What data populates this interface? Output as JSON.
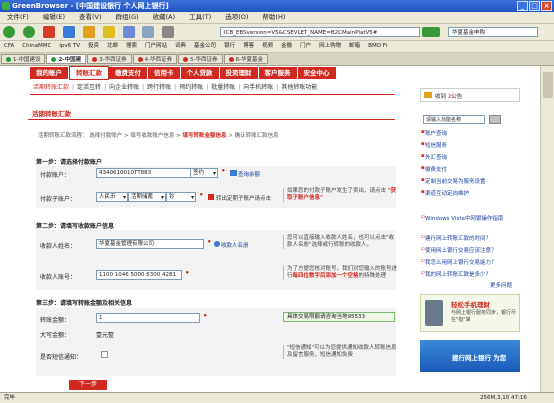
{
  "window": {
    "title": "GreenBrowser - [中国建设银行 个人网上银行]"
  },
  "menu": [
    "文件(F)",
    "编辑(E)",
    "查看(V)",
    "群组(G)",
    "收藏(A)",
    "工具(T)",
    "选项(O)",
    "帮助(H)"
  ],
  "address": {
    "value": "ICB_EBSversion=V5&CSEVLET_NAME=B2CMainPlatV5#"
  },
  "search": {
    "value": "华夏基金申购"
  },
  "links": [
    "CFA",
    "ChinaMMC",
    "ipv6 TV",
    "投资",
    "北邮",
    "搜索",
    "门户网站",
    "词典",
    "基金公司",
    "银行",
    "博客",
    "视频",
    "金融",
    "门户",
    "网上购物",
    "邮箱",
    "BMO Fi"
  ],
  "tabs": [
    {
      "label": "1-中国建设"
    },
    {
      "label": "2-中国建",
      "active": true
    },
    {
      "label": "3-华西证券"
    },
    {
      "label": "4-华西证券"
    },
    {
      "label": "5-华西证券"
    },
    {
      "label": "6-华夏基金"
    }
  ],
  "banknav": [
    {
      "label": "我的账户"
    },
    {
      "label": "转账汇款",
      "active": true
    },
    {
      "label": "缴费支付"
    },
    {
      "label": "信用卡"
    },
    {
      "label": "个人贷款"
    },
    {
      "label": "投资理财"
    },
    {
      "label": "客户服务"
    },
    {
      "label": "安全中心"
    }
  ],
  "subnav": [
    {
      "label": "活期转账汇款",
      "active": true
    },
    {
      "label": "定活互转"
    },
    {
      "label": "向企业转账"
    },
    {
      "label": "跨行转账"
    },
    {
      "label": "预约转账"
    },
    {
      "label": "批量转账"
    },
    {
      "label": "向手机转账"
    },
    {
      "label": "其他转账功能"
    }
  ],
  "page": {
    "title": "活期转账汇款"
  },
  "flow": {
    "prefix": "活期转账汇款流程：",
    "steps": [
      "选择付款账户",
      "填写收款账户信息",
      "填写转账金额信息",
      "确认转账汇款信息"
    ],
    "current": 2
  },
  "section1": {
    "title": "第一步：请选择付款账户",
    "account_label": "付款账户：",
    "account_value": "4340610010TT883",
    "sign_value": "签约",
    "balance_link": "查询余额",
    "subaccount_label": "付款子账户：",
    "currency": "人民币",
    "type": "活期储蓄",
    "cash": "钞",
    "regular_link": "转出定期子账户请点击",
    "tip_text": "如果您的付款子账户发生了卖出，请点击",
    "tip_link": "\"获取子账户信息\""
  },
  "section2": {
    "title": "第二步：请填写收款账户信息",
    "name_label": "收款人姓名：",
    "name_value": "华夏基金管理有限公司",
    "payee_link": "收款人名册",
    "tip1": "您可以直接输入收款人姓名，也可以点击\"收款人名册\"选择或行转账的收款人。",
    "acct_label": "收款人账号：",
    "acct_value": "1100 1046 5000 5300 4281",
    "tip2_a": "为了方便您核对账号，我们对您输入的账号进行",
    "tip2_b": "每四位数字后添加一个空格",
    "tip2_c": "的特殊处理"
  },
  "section3": {
    "title": "第三步：请填写转账金额及相关信息",
    "amount_label": "转账金额：",
    "amount_value": "1",
    "limit_note": "具体交易限额请咨询当地95533",
    "upper_label": "大写金额：",
    "upper_value": "壹元整",
    "sms_label": "是否短信通知：",
    "tip3": "\"短信通知\"可以为您提供通知收款人转账信息及留言服务，短信通知免费"
  },
  "buttons": {
    "next": "下一步"
  },
  "sidebar": {
    "inbox_prefix": "收到",
    "inbox_count": "2",
    "inbox_suffix": "公告",
    "search_placeholder": "请输入功能名称",
    "quick": [
      "账户查询",
      "短信服务",
      "外汇查询",
      "缴费支付",
      "定制当前交易为服务设置",
      "渠道互动定向维护"
    ],
    "news": [
      "Windows Vista中网银操作指南",
      "建行网上转账汇款的时间？",
      "使用网上银行交易应该注意？",
      "我怎么用网上银行交易能力？",
      "我的网上转账汇款是多少？"
    ],
    "more": "更多问题",
    "ad1_title": "轻松手机理财",
    "ad1_text": "与网上银行服务同步，银行尽在\"指\"掌",
    "ad2_title": "建行网上银行 为您"
  },
  "status": {
    "left": "完毕",
    "right": "256M,3,10  47:16"
  },
  "colors": {
    "brand": "#d02a20",
    "link": "#1a3fa0",
    "title": "#2353c4"
  }
}
